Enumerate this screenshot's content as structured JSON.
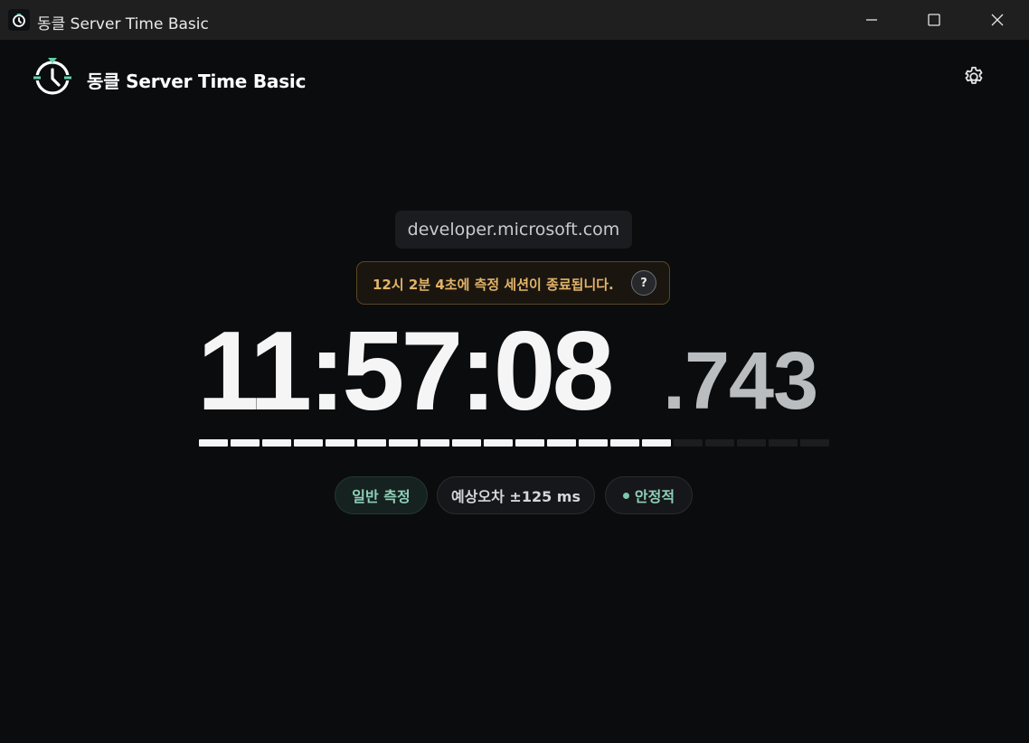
{
  "window": {
    "title": "동클 Server Time Basic",
    "controls": [
      "minimize",
      "maximize",
      "close"
    ]
  },
  "header": {
    "app_title": "동클 Server Time Basic",
    "logo_icon": "clock-logo-icon",
    "settings_icon": "gear-icon"
  },
  "main": {
    "domain": "developer.microsoft.com",
    "notice": "12시 2분 4초에 측정 세션이 종료됩니다.",
    "help_label": "?",
    "time_main": "11:57:08",
    "time_ms": ".743",
    "progress": {
      "segments_total": 20,
      "segments_filled": 15
    },
    "chips": {
      "mode": "일반 측정",
      "error": "예상오차 ±125 ms",
      "state": "안정적"
    }
  },
  "colors": {
    "background": "#0b0c0e",
    "accent_green": "#8fcfb8",
    "notice_amber": "#e3b36a",
    "segment_on": "#f5f5f5",
    "segment_off": "#1c1d20"
  }
}
